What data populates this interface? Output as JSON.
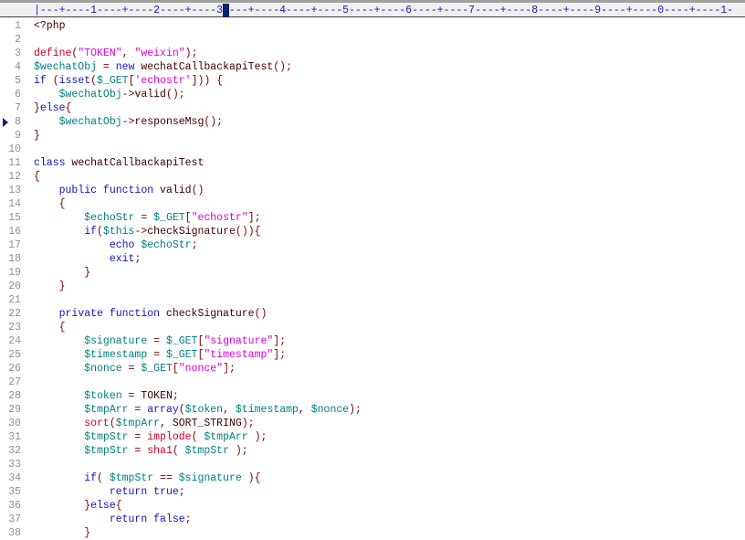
{
  "ruler": {
    "text": "|---+----1----+----2----+----3----+----4----+----5----+----6----+----7----+----8----+----9----+----0----+----1-",
    "cursor_column": 30
  },
  "colors": {
    "keyword": "#1414c8",
    "variable": "#008080",
    "string": "#e000e0",
    "function": "#d00020",
    "operator": "#800000",
    "plain": "#400000"
  },
  "bookmark_line": 8,
  "lines": [
    [
      [
        "plain",
        "<?php"
      ]
    ],
    [],
    [
      [
        "fn",
        "define"
      ],
      [
        "op",
        "("
      ],
      [
        "str",
        "\"TOKEN\""
      ],
      [
        "op",
        ", "
      ],
      [
        "str",
        "\"weixin\""
      ],
      [
        "op",
        ");"
      ]
    ],
    [
      [
        "var",
        "$wechatObj"
      ],
      [
        "op",
        " = "
      ],
      [
        "kw",
        "new"
      ],
      [
        "plain",
        " wechatCallbackapiTest"
      ],
      [
        "op",
        "();"
      ]
    ],
    [
      [
        "kw",
        "if"
      ],
      [
        "op",
        " ("
      ],
      [
        "kw",
        "isset"
      ],
      [
        "op",
        "("
      ],
      [
        "var",
        "$_GET"
      ],
      [
        "op",
        "["
      ],
      [
        "str",
        "'echostr'"
      ],
      [
        "op",
        "])) {"
      ]
    ],
    [
      [
        "plain",
        "    "
      ],
      [
        "var",
        "$wechatObj"
      ],
      [
        "op",
        "->"
      ],
      [
        "plain",
        "valid"
      ],
      [
        "op",
        "();"
      ]
    ],
    [
      [
        "op",
        "}"
      ],
      [
        "kw",
        "else"
      ],
      [
        "op",
        "{"
      ]
    ],
    [
      [
        "plain",
        "    "
      ],
      [
        "var",
        "$wechatObj"
      ],
      [
        "op",
        "->"
      ],
      [
        "plain",
        "responseMsg"
      ],
      [
        "op",
        "();"
      ]
    ],
    [
      [
        "op",
        "}"
      ]
    ],
    [],
    [
      [
        "kw",
        "class"
      ],
      [
        "plain",
        " wechatCallbackapiTest"
      ]
    ],
    [
      [
        "op",
        "{"
      ]
    ],
    [
      [
        "plain",
        "    "
      ],
      [
        "kw",
        "public function"
      ],
      [
        "plain",
        " valid"
      ],
      [
        "op",
        "()"
      ]
    ],
    [
      [
        "plain",
        "    "
      ],
      [
        "op",
        "{"
      ]
    ],
    [
      [
        "plain",
        "        "
      ],
      [
        "var",
        "$echoStr"
      ],
      [
        "op",
        " = "
      ],
      [
        "var",
        "$_GET"
      ],
      [
        "op",
        "["
      ],
      [
        "str",
        "\"echostr\""
      ],
      [
        "op",
        "];"
      ]
    ],
    [
      [
        "plain",
        "        "
      ],
      [
        "kw",
        "if"
      ],
      [
        "op",
        "("
      ],
      [
        "var",
        "$this"
      ],
      [
        "op",
        "->"
      ],
      [
        "plain",
        "checkSignature"
      ],
      [
        "op",
        "()){"
      ]
    ],
    [
      [
        "plain",
        "            "
      ],
      [
        "kw",
        "echo"
      ],
      [
        "plain",
        " "
      ],
      [
        "var",
        "$echoStr"
      ],
      [
        "op",
        ";"
      ]
    ],
    [
      [
        "plain",
        "            "
      ],
      [
        "kw",
        "exit"
      ],
      [
        "op",
        ";"
      ]
    ],
    [
      [
        "plain",
        "        "
      ],
      [
        "op",
        "}"
      ]
    ],
    [
      [
        "plain",
        "    "
      ],
      [
        "op",
        "}"
      ]
    ],
    [],
    [
      [
        "plain",
        "    "
      ],
      [
        "kw",
        "private function"
      ],
      [
        "plain",
        " checkSignature"
      ],
      [
        "op",
        "()"
      ]
    ],
    [
      [
        "plain",
        "    "
      ],
      [
        "op",
        "{"
      ]
    ],
    [
      [
        "plain",
        "        "
      ],
      [
        "var",
        "$signature"
      ],
      [
        "op",
        " = "
      ],
      [
        "var",
        "$_GET"
      ],
      [
        "op",
        "["
      ],
      [
        "str",
        "\"signature\""
      ],
      [
        "op",
        "];"
      ]
    ],
    [
      [
        "plain",
        "        "
      ],
      [
        "var",
        "$timestamp"
      ],
      [
        "op",
        " = "
      ],
      [
        "var",
        "$_GET"
      ],
      [
        "op",
        "["
      ],
      [
        "str",
        "\"timestamp\""
      ],
      [
        "op",
        "];"
      ]
    ],
    [
      [
        "plain",
        "        "
      ],
      [
        "var",
        "$nonce"
      ],
      [
        "op",
        " = "
      ],
      [
        "var",
        "$_GET"
      ],
      [
        "op",
        "["
      ],
      [
        "str",
        "\"nonce\""
      ],
      [
        "op",
        "];"
      ]
    ],
    [],
    [
      [
        "plain",
        "        "
      ],
      [
        "var",
        "$token"
      ],
      [
        "op",
        " = "
      ],
      [
        "plain",
        "TOKEN"
      ],
      [
        "op",
        ";"
      ]
    ],
    [
      [
        "plain",
        "        "
      ],
      [
        "var",
        "$tmpArr"
      ],
      [
        "op",
        " = "
      ],
      [
        "kw",
        "array"
      ],
      [
        "op",
        "("
      ],
      [
        "var",
        "$token"
      ],
      [
        "op",
        ", "
      ],
      [
        "var",
        "$timestamp"
      ],
      [
        "op",
        ", "
      ],
      [
        "var",
        "$nonce"
      ],
      [
        "op",
        ");"
      ]
    ],
    [
      [
        "plain",
        "        "
      ],
      [
        "fn",
        "sort"
      ],
      [
        "op",
        "("
      ],
      [
        "var",
        "$tmpArr"
      ],
      [
        "op",
        ", "
      ],
      [
        "plain",
        "SORT_STRING"
      ],
      [
        "op",
        ");"
      ]
    ],
    [
      [
        "plain",
        "        "
      ],
      [
        "var",
        "$tmpStr"
      ],
      [
        "op",
        " = "
      ],
      [
        "fn",
        "implode"
      ],
      [
        "op",
        "( "
      ],
      [
        "var",
        "$tmpArr"
      ],
      [
        "op",
        " );"
      ]
    ],
    [
      [
        "plain",
        "        "
      ],
      [
        "var",
        "$tmpStr"
      ],
      [
        "op",
        " = "
      ],
      [
        "fn",
        "sha1"
      ],
      [
        "op",
        "( "
      ],
      [
        "var",
        "$tmpStr"
      ],
      [
        "op",
        " );"
      ]
    ],
    [],
    [
      [
        "plain",
        "        "
      ],
      [
        "kw",
        "if"
      ],
      [
        "op",
        "( "
      ],
      [
        "var",
        "$tmpStr"
      ],
      [
        "op",
        " == "
      ],
      [
        "var",
        "$signature"
      ],
      [
        "op",
        " ){"
      ]
    ],
    [
      [
        "plain",
        "            "
      ],
      [
        "kw",
        "return true"
      ],
      [
        "op",
        ";"
      ]
    ],
    [
      [
        "plain",
        "        "
      ],
      [
        "op",
        "}"
      ],
      [
        "kw",
        "else"
      ],
      [
        "op",
        "{"
      ]
    ],
    [
      [
        "plain",
        "            "
      ],
      [
        "kw",
        "return false"
      ],
      [
        "op",
        ";"
      ]
    ],
    [
      [
        "plain",
        "        "
      ],
      [
        "op",
        "}"
      ]
    ]
  ]
}
